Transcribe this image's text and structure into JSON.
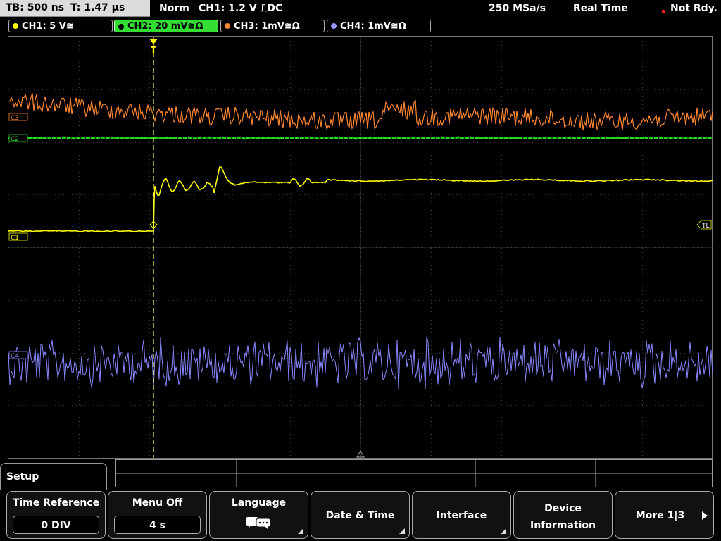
{
  "status": {
    "timebase": "TB: 500 ns",
    "trigger_time": "T: 1.47 µs",
    "mode": "Norm",
    "trigger": "CH1: 1.2 V ⎍DC",
    "sample_rate": "250 MSa/s",
    "acq_mode": "Real Time",
    "state": "Not Rdy."
  },
  "channels": [
    {
      "label": "CH1: 5 V≅",
      "color": "#ffff00"
    },
    {
      "label": "CH2: 20 mV≅Ω",
      "color": "#33dd33"
    },
    {
      "label": "CH3: 1mV≅Ω",
      "color": "#ff8833"
    },
    {
      "label": "CH4: 1mV≅Ω",
      "color": "#9999ff"
    }
  ],
  "markers": {
    "c1": "C1",
    "c2": "C2",
    "c3": "C3",
    "c4": "C4",
    "tl": "TL",
    "trig": "T"
  },
  "setup": {
    "title": "Setup"
  },
  "softkeys": {
    "time_reference": {
      "label": "Time Reference",
      "value": "0 DIV"
    },
    "menu_off": {
      "label": "Menu Off",
      "value": "4 s"
    },
    "language": {
      "label": "Language"
    },
    "date_time": {
      "label": "Date & Time"
    },
    "interface": {
      "label": "Interface"
    },
    "device_info": {
      "line1": "Device",
      "line2": "Information"
    },
    "more": {
      "label": "More 1|3"
    }
  }
}
